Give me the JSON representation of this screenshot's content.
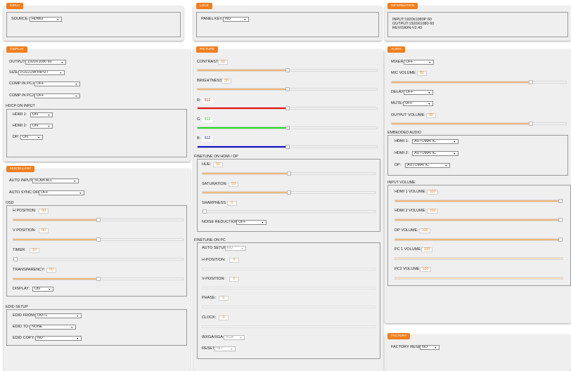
{
  "input": {
    "title": "INPUT",
    "source_label": "SOURCE:",
    "source_value": "HDMI2"
  },
  "lock": {
    "title": "LOCK",
    "panel_key_label": "PANEL KEY:",
    "panel_key_value": "NO"
  },
  "information": {
    "title": "INFORMATION",
    "input_line": "INPUT:1920x1080P 60",
    "output_line": "OUTPUT:1920X1080 60",
    "revision_line": "REVISION:V2.43"
  },
  "display": {
    "title": "DISPLAY",
    "output_label": "OUTPUT:",
    "output_value": "1920X1080 60",
    "size_label": "SIZE:",
    "size_value": "FOLLOW INPUT",
    "comp_pc1_label": "COMP IN PC1:",
    "comp_pc1_value": "OFF",
    "comp_pc2_label": "COMP IN PC2:",
    "comp_pc2_value": "OFF",
    "hdcp_section": "HDCP ON INPUT",
    "hdmi1_label": "HDMI 1:",
    "hdmi1_value": "ON",
    "hdmi2_label": "HDMI 2:",
    "hdmi2_value": "ON",
    "dp_label": "DP:",
    "dp_value": "ON"
  },
  "picture": {
    "title": "PICTURE",
    "contrast_label": "CONTRAST:",
    "contrast_value": "50",
    "contrast_level": 0.5,
    "brightness_label": "BRIGHTNESS:",
    "brightness_value": "50",
    "brightness_level": 0.5,
    "r_label": "R:",
    "r_value": "512",
    "r_level": 0.5,
    "g_label": "G:",
    "g_value": "512",
    "g_level": 0.5,
    "b_label": "B:",
    "b_value": "512",
    "b_level": 0.5,
    "colors": {
      "r": "#ee1111",
      "g": "#22dd22",
      "b": "#1111cc",
      "accent": "#ef7e1e"
    }
  },
  "finetune_hdmi": {
    "section": "FINETUNE ON HDMI / DP",
    "hue_label": "HUE:",
    "hue_value": "50",
    "hue_level": 0.5,
    "saturation_label": "SATURATION:",
    "saturation_value": "50",
    "saturation_level": 0.5,
    "sharpness_label": "SHARPNESS:",
    "sharpness_value": "0",
    "sharpness_level": 0,
    "noise_label": "NOISE REDUCTION:",
    "noise_value": "OFF"
  },
  "finetune_pc": {
    "section": "FINETUNE ON PC",
    "auto_setup_label": "AUTO SETUP:",
    "auto_setup_value": "NO",
    "hpos_label": "H-POSITION:",
    "hpos_value": "0",
    "vpos_label": "V-POSITION:",
    "vpos_value": "0",
    "phase_label": "PHASE:",
    "phase_value": "0",
    "clock_label": "CLOCK:",
    "clock_value": "0",
    "wxga_label": "WXGA/XGA:",
    "wxga_value": "XGA",
    "reset_label": "RESET:",
    "reset_value": "NO"
  },
  "misc": {
    "title": "MISCELLANY",
    "auto_input_label": "AUTO INPUT:",
    "auto_input_value": "SCAN ALL",
    "auto_sync_label": "AUTO SYNC OFF:",
    "auto_sync_value": "OFF",
    "osd_section": "OSD",
    "hpos_label": "H POSITION:",
    "hpos_value": "50",
    "hpos_level": 0.5,
    "vpos_label": "V POSITION:",
    "vpos_value": "50",
    "vpos_level": 0.5,
    "timer_label": "TIMER:",
    "timer_value": "10",
    "timer_level": 0,
    "transparency_label": "TRANSPARENCY:",
    "transparency_value": "50",
    "transparency_level": 0.5,
    "display_label": "DISPLAY:",
    "display_value": "ON",
    "edid_section": "EDID SETUP",
    "edid_from_label": "EDID FROM:",
    "edid_from_value": "OUT1",
    "edid_to_label": "EDID TO:",
    "edid_to_value": "NONE",
    "edid_copy_label": "EDID COPY:",
    "edid_copy_value": "NO"
  },
  "audio": {
    "title": "AUDIO",
    "mixer_label": "MIXER:",
    "mixer_value": "OFF",
    "mic_label": "MIC VOLUME:",
    "mic_value": "80",
    "mic_level": 0.8,
    "delay_label": "DELAY:",
    "delay_value": "OFF",
    "mute_label": "MUTE:",
    "mute_value": "OFF",
    "output_label": "OUTPUT VOLUME:",
    "output_value": "80",
    "output_level": 0.8,
    "embedded_section": "EMBEDDED AUDIO",
    "hdmi1_label": "HDMI 1:",
    "hdmi1_value": "AUTOMATIC",
    "hdmi2_label": "HDMI 2:",
    "hdmi2_value": "AUTOMATIC",
    "dp_label": "DP:",
    "dp_value": "AUTOMATIC",
    "input_volume_section": "INPUT VOLUME",
    "hdmi1_vol_label": "HDMI 1 VOLUME:",
    "hdmi1_vol_value": "100",
    "hdmi1_vol_level": 1,
    "hdmi2_vol_label": "HDMI 2 VOLUME:",
    "hdmi2_vol_value": "100",
    "hdmi2_vol_level": 1,
    "dp_vol_label": "DP VOLUME:",
    "dp_vol_value": "100",
    "dp_vol_level": 1,
    "pc1_vol_label": "PC 1 VOLUME:",
    "pc1_vol_value": "100",
    "pc1_vol_level": 1,
    "pc2_vol_label": "PC2 VOLUME:",
    "pc2_vol_value": "100",
    "pc2_vol_level": 1
  },
  "factory": {
    "title": "FACTORY",
    "reset_label": "FACTORY RESET:",
    "reset_value": "NO"
  }
}
